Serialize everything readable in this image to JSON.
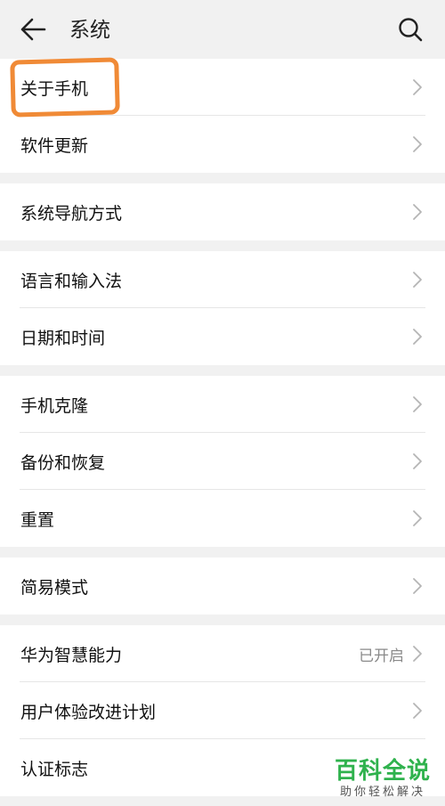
{
  "header": {
    "title": "系统",
    "back_icon": "back-arrow-icon",
    "search_icon": "search-icon"
  },
  "groups": [
    {
      "items": [
        {
          "label": "关于手机"
        },
        {
          "label": "软件更新"
        }
      ]
    },
    {
      "items": [
        {
          "label": "系统导航方式"
        }
      ]
    },
    {
      "items": [
        {
          "label": "语言和输入法"
        },
        {
          "label": "日期和时间"
        }
      ]
    },
    {
      "items": [
        {
          "label": "手机克隆"
        },
        {
          "label": "备份和恢复"
        },
        {
          "label": "重置"
        }
      ]
    },
    {
      "items": [
        {
          "label": "简易模式"
        }
      ]
    },
    {
      "items": [
        {
          "label": "华为智慧能力",
          "status": "已开启"
        },
        {
          "label": "用户体验改进计划"
        },
        {
          "label": "认证标志"
        }
      ]
    }
  ],
  "annotation": {
    "highlight_color": "#f08a36"
  },
  "watermark": {
    "main": "百科全说",
    "sub": "助你轻松解决",
    "color": "#2fb24d"
  }
}
